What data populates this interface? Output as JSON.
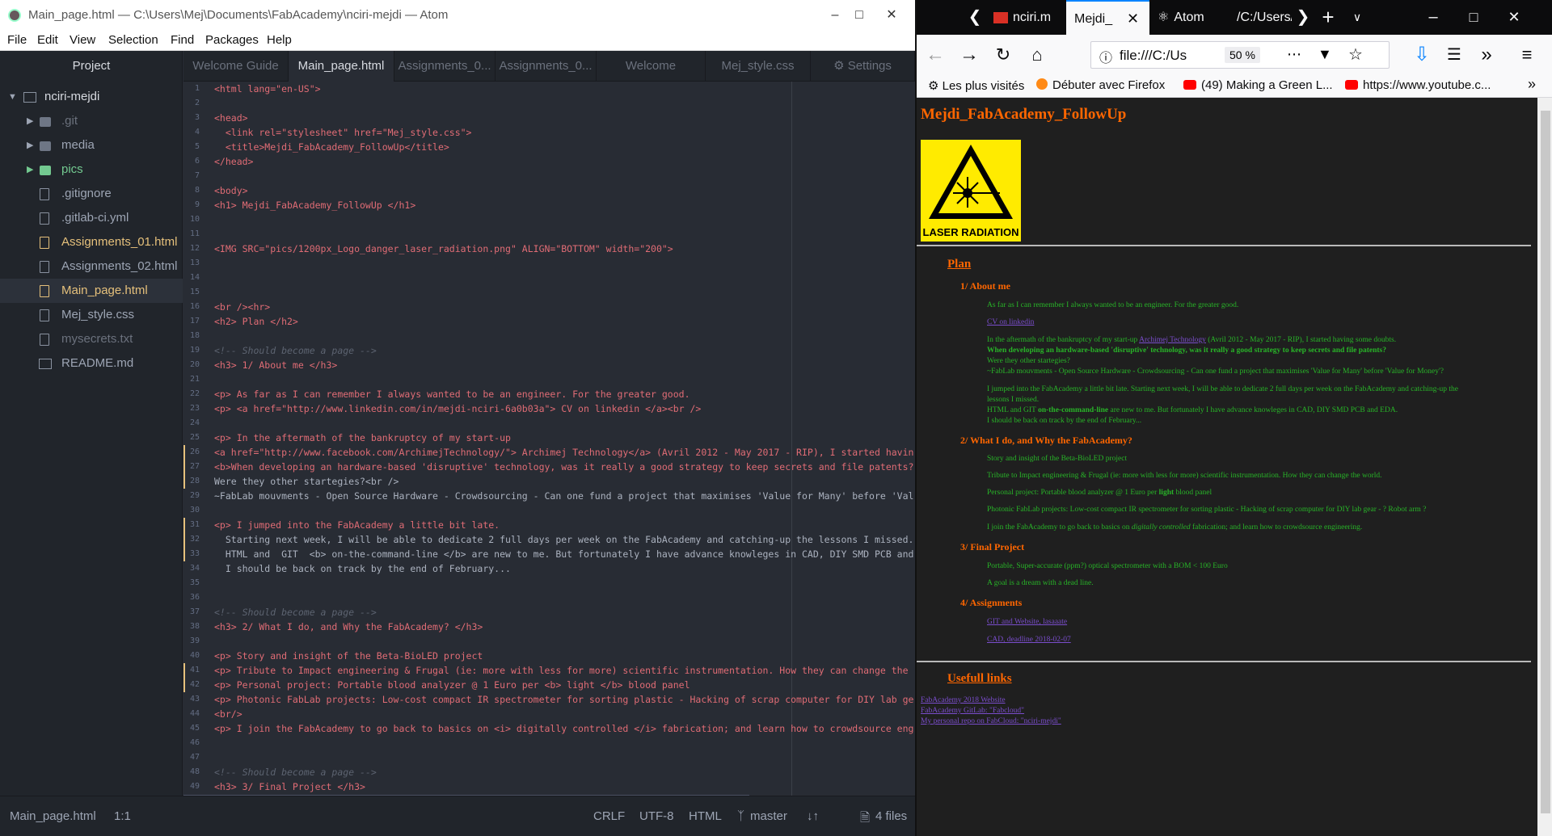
{
  "atom": {
    "window_title": "Main_page.html — C:\\Users\\Mej\\Documents\\FabAcademy\\nciri-mejdi — Atom",
    "menu": [
      "File",
      "Edit",
      "View",
      "Selection",
      "Find",
      "Packages",
      "Help"
    ],
    "tree": {
      "header": "Project",
      "root": "nciri-mejdi",
      "items": [
        ".git",
        "media",
        "pics",
        ".gitignore",
        ".gitlab-ci.yml",
        "Assignments_01.html",
        "Assignments_02.html",
        "Main_page.html",
        "Mej_style.css",
        "mysecrets.txt",
        "README.md"
      ]
    },
    "tabs": [
      "Welcome Guide",
      "Main_page.html",
      "Assignments_0...",
      "Assignments_0...",
      "Welcome",
      "Mej_style.css",
      "Settings"
    ],
    "code": [
      "<html lang=\"en-US\">",
      "",
      "<head>",
      "  <link rel=\"stylesheet\" href=\"Mej_style.css\">",
      "  <title>Mejdi_FabAcademy_FollowUp</title>",
      "</head>",
      "",
      "<body>",
      "<h1> Mejdi_FabAcademy_FollowUp </h1>",
      "",
      "",
      "<IMG SRC=\"pics/1200px_Logo_danger_laser_radiation.png\" ALIGN=\"BOTTOM\" width=\"200\">",
      "",
      "",
      "",
      "<br /><hr>",
      "<h2> Plan </h2>",
      "",
      "<!-- Should become a page -->",
      "<h3> 1/ About me </h3>",
      "",
      "<p> As far as I can remember I always wanted to be an engineer. For the greater good.",
      "<p> <a href=\"http://www.linkedin.com/in/mejdi-nciri-6a0b03a\"> CV on linkedin </a><br />",
      "",
      "<p> In the aftermath of the bankruptcy of my start-up",
      "<a href=\"http://www.facebook.com/ArchimejTechnology/\"> Archimej Technology</a> (Avril 2012 - May 2017 - RIP), I started havin",
      "<b>When developing an hardware-based 'disruptive' technology, was it really a good strategy to keep secrets and file patents?",
      "Were they other startegies?<br />",
      "~FabLab mouvments - Open Source Hardware - Crowdsourcing - Can one fund a project that maximises 'Value for Many' before 'Val",
      "",
      "<p> I jumped into the FabAcademy a little bit late.",
      "  Starting next week, I will be able to dedicate 2 full days per week on the FabAcademy and catching-up the lessons I missed.",
      "  HTML and  GIT  <b> on-the-command-line </b> are new to me. But fortunately I have advance knowleges in CAD, DIY SMD PCB and",
      "  I should be back on track by the end of February...",
      "",
      "",
      "<!-- Should become a page -->",
      "<h3> 2/ What I do, and Why the FabAcademy? </h3>",
      "",
      "<p> Story and insight of the Beta-BioLED project",
      "<p> Tribute to Impact engineering & Frugal (ie: more with less for more) scientific instrumentation. How they can change the",
      "<p> Personal project: Portable blood analyzer @ 1 Euro per <b> light </b> blood panel",
      "<p> Photonic FabLab projects: Low-cost compact IR spectrometer for sorting plastic - Hacking of scrap computer for DIY lab ge",
      "<br/>",
      "<p> I join the FabAcademy to go back to basics on <i> digitally controlled </i> fabrication; and learn how to crowdsource eng",
      "",
      "",
      "<!-- Should become a page -->",
      "<h3> 3/ Final Project </h3>"
    ],
    "status": {
      "file": "Main_page.html",
      "cursor": "1:1",
      "line_ending": "CRLF",
      "encoding": "UTF-8",
      "grammar": "HTML",
      "branch": "master",
      "files": "4 files"
    }
  },
  "firefox": {
    "tabs": [
      "nciri.m",
      "Mejdi_",
      "Atom",
      "/C:/Users/"
    ],
    "url": "file:///C:/Us",
    "zoom": "50 %",
    "bookmarks": [
      "Les plus visités",
      "Débuter avec Firefox",
      "(49) Making a Green L...",
      "https://www.youtube.c..."
    ],
    "page": {
      "h1": "Mejdi_FabAcademy_FollowUp",
      "image_caption": "LASER RADIATION",
      "plan": "Plan",
      "s1": {
        "title": "1/ About me",
        "p1": "As far as I can remember I always wanted to be an engineer. For the greater good.",
        "cv_link": "CV on linkedin",
        "p3_before": "In the aftermath of the bankruptcy of my start-up ",
        "p3_link": "Archimej Technology",
        "p3_after": " (Avril 2012 - May 2017 - RIP), I started having some doubts.",
        "p4": "When developing an hardware-based 'disruptive' technology, was it really a good strategy to keep secrets and file patents?",
        "p5": "Were they other startegies?",
        "p6": "~FabLab mouvments - Open Source Hardware - Crowdsourcing - Can one fund a project that maximises 'Value for Many' before 'Value for Money'?",
        "p7": "I jumped into the FabAcademy a little bit late. Starting next week, I will be able to dedicate 2 full days per week on the FabAcademy and catching-up the",
        "p7b": "lessons I missed.",
        "p8_before": "HTML and GIT ",
        "p8_bold": "on-the-command-line",
        "p8_after": " are new to me. But fortunately I have advance knowleges in CAD, DIY SMD PCB and EDA.",
        "p9": "I should be back on track by the end of February..."
      },
      "s2": {
        "title": "2/ What I do, and Why the FabAcademy?",
        "p1": "Story and insight of the Beta-BioLED project",
        "p2": "Tribute to Impact engineering & Frugal (ie: more with less for more) scientific instrumentation. How they can change the world.",
        "p3_before": "Personal project: Portable blood analyzer @ 1 Euro per ",
        "p3_bold": "light",
        "p3_after": " blood panel",
        "p4": "Photonic FabLab projects: Low-cost compact IR spectrometer for sorting plastic - Hacking of scrap computer for DIY lab gear - ? Robot arm ?",
        "p5_before": "I join the FabAcademy to go back to basics on ",
        "p5_italic": "digitally controlled",
        "p5_after": " fabrication; and learn how to crowdsource engineering."
      },
      "s3": {
        "title": "3/ Final Project",
        "p1": "Portable, Super-accurate (ppm?) optical spectrometer with a BOM < 100 Euro",
        "p2": "A goal is a dream with a dead line."
      },
      "s4": {
        "title": "4/ Assignments",
        "l1": "GIT and Website, lasaaate",
        "l2": "CAD, deadline 2018-02-07"
      },
      "useful": "Usefull links",
      "links": [
        "FabAcademy 2018 Website",
        "FabAcademy GitLab: \"Fabcloud\"",
        "My personal repo on FabCloud: \"nciri-mejdi\""
      ]
    }
  }
}
